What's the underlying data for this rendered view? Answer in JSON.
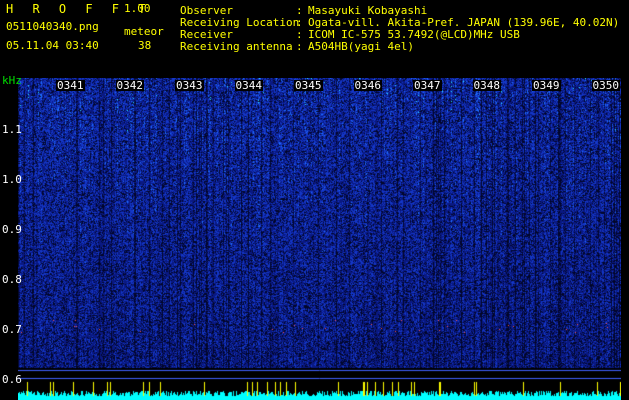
{
  "app": {
    "name": "H R O F F T",
    "version": "1.00"
  },
  "file": {
    "name": "0511040340.png",
    "datetime": "05.11.04 03:40"
  },
  "meteor": {
    "label": "meteor",
    "count": "38"
  },
  "meta": [
    {
      "key": "Observer",
      "value": "Masayuki Kobayashi"
    },
    {
      "key": "Receiving Location",
      "value": "Ogata-vill. Akita-Pref. JAPAN (139.96E, 40.02N)"
    },
    {
      "key": "Receiver",
      "value": "ICOM IC-575 53.7492(@LCD)MHz USB"
    },
    {
      "key": "Receiving antenna",
      "value": "A504HB(yagi 4el)"
    }
  ],
  "meta_separator": ":",
  "chart_data": {
    "type": "heatmap",
    "ylabel": "kHz",
    "yticks": [
      "1.1",
      "1.0",
      "0.9",
      "0.8",
      "0.7",
      "0.6"
    ],
    "xticks": [
      "0341",
      "0342",
      "0343",
      "0344",
      "0345",
      "0346",
      "0347",
      "0348",
      "0349",
      "0350"
    ],
    "ylim": [
      0.58,
      1.18
    ],
    "xlim": [
      "0340",
      "0350"
    ],
    "colors": {
      "background": "#000000",
      "low": "#0a1a8c",
      "mid": "#1f4dff",
      "high": "#00e0ff",
      "peak": "#ffff00",
      "text": "#ffffff",
      "title": "#ffff00",
      "label": "#00e000",
      "bar": "#00ffff"
    }
  }
}
